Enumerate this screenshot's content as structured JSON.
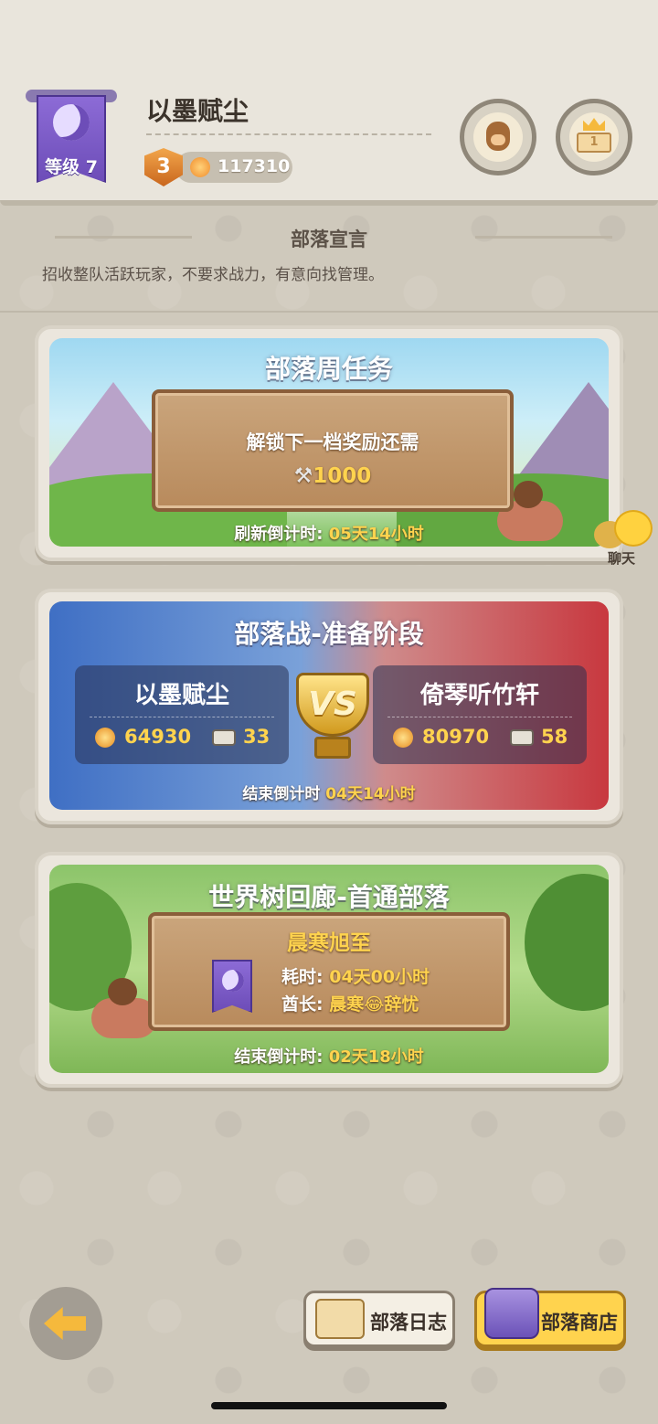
{
  "header": {
    "clan_name": "以墨赋尘",
    "level_label": "等级 7",
    "rank": "3",
    "power": "117310"
  },
  "manifesto": {
    "title": "部落宣言",
    "text": "招收整队活跃玩家，不要求战力，有意向找管理。"
  },
  "weekly_task": {
    "title": "部落周任务",
    "subtitle": "解锁下一档奖励还需",
    "amount": "1000",
    "countdown_label": "刷新倒计时:",
    "countdown_value": "05天14小时"
  },
  "chat": {
    "label": "聊天"
  },
  "war": {
    "title": "部落战-准备阶段",
    "vs": "VS",
    "left_team": {
      "name": "以墨赋尘",
      "power": "64930",
      "count": "33"
    },
    "right_team": {
      "name": "倚琴听竹轩",
      "power": "80970",
      "count": "58"
    },
    "countdown_label": "结束倒计时",
    "countdown_value": "04天14小时"
  },
  "world_tree": {
    "title": "世界树回廊-首通部落",
    "clan": "晨寒旭至",
    "time_label": "耗时:",
    "time_value": "04天00小时",
    "chief_label": "酋长:",
    "chief_value": "晨寒😂辞忧",
    "countdown_label": "结束倒计时:",
    "countdown_value": "02天18小时"
  },
  "bottom": {
    "log_label": "部落日志",
    "shop_label": "部落商店"
  }
}
